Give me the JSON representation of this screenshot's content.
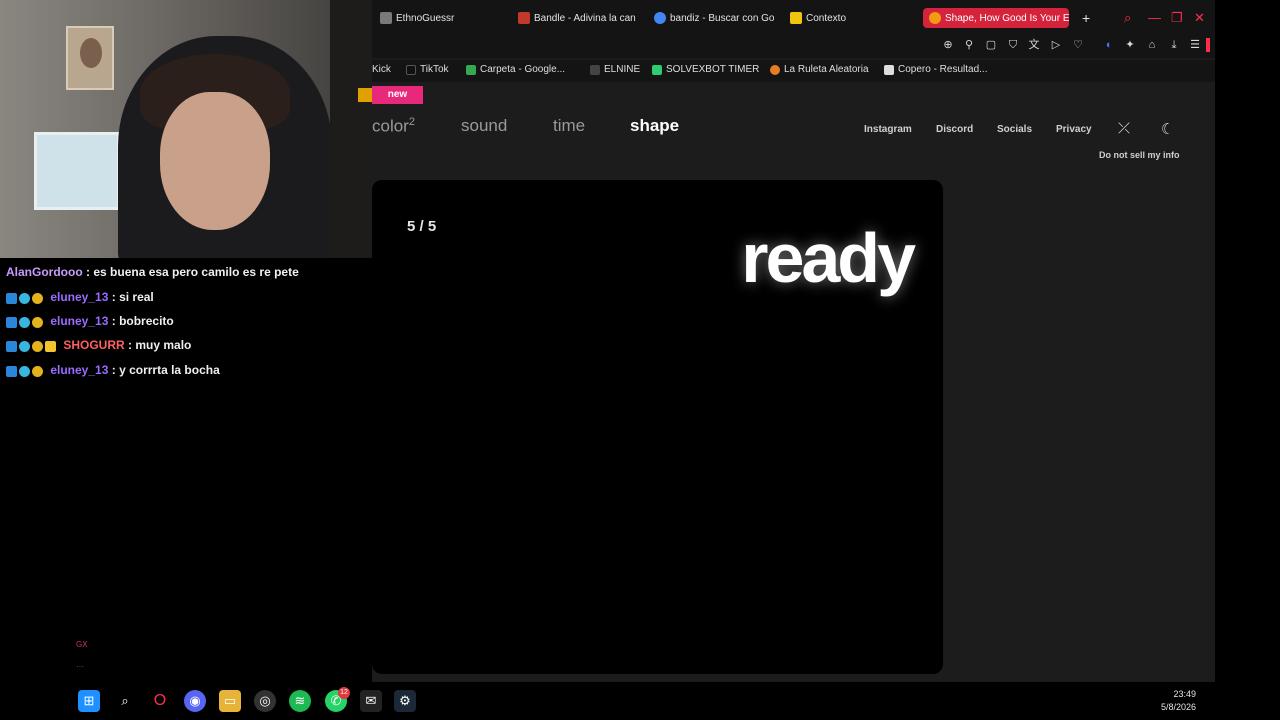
{
  "chat": {
    "messages": [
      {
        "user": "AlanGordooo",
        "text": ": es buena esa pero camilo es re pete",
        "color": "#c99bff",
        "badges": []
      },
      {
        "user": "eluney_13",
        "text": ": si real",
        "color": "#9b6bff",
        "badges": [
          "blue",
          "cyan",
          "gold"
        ]
      },
      {
        "user": "eluney_13",
        "text": ": bobrecito",
        "color": "#9b6bff",
        "badges": [
          "blue",
          "cyan",
          "gold"
        ]
      },
      {
        "user": "SHOGURR",
        "text": ": muy malo",
        "color": "#ff5f5f",
        "badges": [
          "blue",
          "cyan",
          "gold",
          "crown"
        ]
      },
      {
        "user": "eluney_13",
        "text": ": y corrrta la bocha",
        "color": "#9b6bff",
        "badges": [
          "blue",
          "cyan",
          "gold"
        ]
      }
    ],
    "side_mark": "GX"
  },
  "browser": {
    "tabs": [
      {
        "label": "EthnoGuessr",
        "favicon_color": "#7a7a7a",
        "active": false
      },
      {
        "label": "Bandle - Adivina la can",
        "favicon_color": "#c0392b",
        "active": false
      },
      {
        "label": "bandiz - Buscar con Go",
        "favicon_color": "#4285f4",
        "active": false
      },
      {
        "label": "Contexto",
        "favicon_color": "#f1c40f",
        "active": false
      },
      {
        "label": "Shape, How Good Is Your E",
        "favicon_color": "#f39c12",
        "active": true
      }
    ],
    "new_tab_icon": "+",
    "window_controls": [
      "search-icon",
      "minimize-icon",
      "restore-icon",
      "close-icon"
    ],
    "bookmarks": [
      {
        "label": "Kick",
        "favicon_color": ""
      },
      {
        "label": "TikTok",
        "favicon_color": "#111111"
      },
      {
        "label": "Carpeta - Google...",
        "favicon_color": "#34a853"
      },
      {
        "label": "ELNINE",
        "favicon_color": "#444444"
      },
      {
        "label": "SOLVEXBOT TIMER",
        "favicon_color": "#2ecc71"
      },
      {
        "label": "La Ruleta Aleatoria",
        "favicon_color": "#e67e22"
      },
      {
        "label": "Copero - Resultad...",
        "favicon_color": "#dddddd"
      }
    ],
    "page": {
      "new_badge": "new",
      "nav": [
        {
          "label": "color",
          "sup": "2",
          "active": false
        },
        {
          "label": "sound",
          "sup": "",
          "active": false
        },
        {
          "label": "time",
          "sup": "",
          "active": false
        },
        {
          "label": "shape",
          "sup": "",
          "active": true
        }
      ],
      "links": [
        "Instagram",
        "Discord",
        "Socials",
        "Privacy"
      ],
      "do_not_sell": "Do not sell my info",
      "game": {
        "counter": "5 / 5",
        "status": "ready"
      }
    }
  },
  "taskbar": {
    "time": "23:49",
    "date": "5/8/2026",
    "whatsapp_badge": "12"
  },
  "colors": {
    "accent_red": "#ff2e4c",
    "new_badge_pink": "#e8287a"
  }
}
